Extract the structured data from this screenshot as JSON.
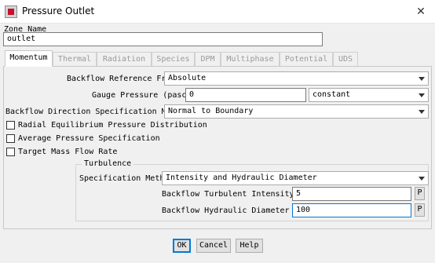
{
  "window": {
    "title": "Pressure Outlet",
    "close_glyph": "✕",
    "icon": "fluent-app-icon"
  },
  "zone": {
    "label": "Zone Name",
    "value": "outlet"
  },
  "tabs": [
    {
      "label": "Momentum",
      "active": true
    },
    {
      "label": "Thermal",
      "active": false
    },
    {
      "label": "Radiation",
      "active": false
    },
    {
      "label": "Species",
      "active": false
    },
    {
      "label": "DPM",
      "active": false
    },
    {
      "label": "Multiphase",
      "active": false
    },
    {
      "label": "Potential",
      "active": false
    },
    {
      "label": "UDS",
      "active": false
    }
  ],
  "momentum": {
    "backflow_ref_frame": {
      "label": "Backflow Reference Frame",
      "value": "Absolute"
    },
    "gauge_pressure": {
      "label": "Gauge Pressure (pascal)",
      "value": "0",
      "method": "constant"
    },
    "backflow_direction": {
      "label": "Backflow Direction Specification Method",
      "value": "Normal to Boundary"
    },
    "checkboxes": [
      {
        "label": "Radial Equilibrium Pressure Distribution",
        "checked": false
      },
      {
        "label": "Average Pressure Specification",
        "checked": false
      },
      {
        "label": "Target Mass Flow Rate",
        "checked": false
      }
    ],
    "turbulence": {
      "title": "Turbulence",
      "spec_method": {
        "label": "Specification Method",
        "value": "Intensity and Hydraulic Diameter"
      },
      "intensity": {
        "label": "Backflow Turbulent Intensity (%)",
        "value": "5",
        "param_button": "P"
      },
      "hydraulic_diameter": {
        "label": "Backflow Hydraulic Diameter (mm)",
        "value": "100",
        "param_button": "P"
      }
    }
  },
  "buttons": {
    "ok": "OK",
    "cancel": "Cancel",
    "help": "Help"
  },
  "colors": {
    "focus_accent": "#0078d7",
    "dialog_bg": "#f0f0f0",
    "inactive_tab_text": "#9a9a9a"
  }
}
